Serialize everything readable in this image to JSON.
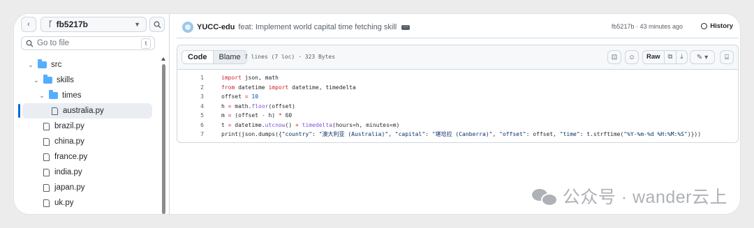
{
  "sidebar": {
    "branch": "fb5217b",
    "goto_placeholder": "Go to file",
    "goto_shortcut": "t",
    "tree": [
      {
        "label": "src",
        "depth": 0,
        "type": "folder"
      },
      {
        "label": "skills",
        "depth": 1,
        "type": "folder"
      },
      {
        "label": "times",
        "depth": 2,
        "type": "folder"
      },
      {
        "label": "australia.py",
        "depth": 3,
        "type": "file",
        "selected": true
      },
      {
        "label": "brazil.py",
        "depth": 3,
        "type": "file"
      },
      {
        "label": "china.py",
        "depth": 3,
        "type": "file"
      },
      {
        "label": "france.py",
        "depth": 3,
        "type": "file"
      },
      {
        "label": "india.py",
        "depth": 3,
        "type": "file"
      },
      {
        "label": "japan.py",
        "depth": 3,
        "type": "file"
      },
      {
        "label": "uk.py",
        "depth": 3,
        "type": "file"
      }
    ]
  },
  "commit": {
    "author": "YUCC-edu",
    "message": "feat: Implement world capital time fetching skill",
    "meta": "fb5217b · 43 minutes ago",
    "history_label": "History"
  },
  "file": {
    "tab_code": "Code",
    "tab_blame": "Blame",
    "info": "7 lines (7 loc) · 323 Bytes",
    "raw_label": "Raw",
    "lines": [
      "import json, math",
      "from datetime import datetime, timedelta",
      "offset = 10",
      "h = math.floor(offset)",
      "m = (offset - h) * 60",
      "t = datetime.utcnow() + timedelta(hours=h, minutes=m)",
      "print(json.dumps({\"country\": \"澳大利亚 (Australia)\", \"capital\": \"堪培拉 (Canberra)\", \"offset\": offset, \"time\": t.strftime(\"%Y-%m-%d %H:%M:%S\")}))"
    ]
  },
  "watermark": "公众号 · wander云上",
  "colors": {
    "accent": "#0969da",
    "folder": "#54aeff",
    "keyword": "#cf222e",
    "function": "#8250df"
  }
}
